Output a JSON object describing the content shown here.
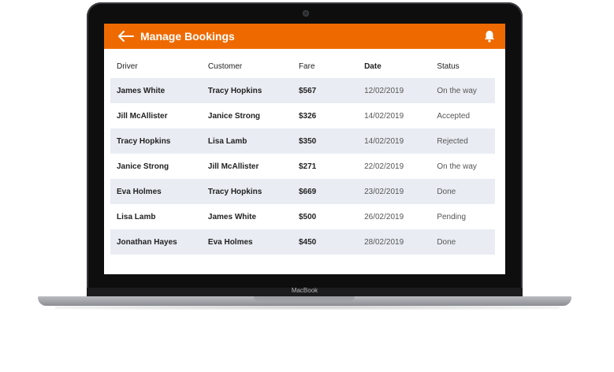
{
  "device": {
    "brand_label": "MacBook"
  },
  "header": {
    "title": "Manage Bookings",
    "back_icon": "arrow-left-icon",
    "bell_icon": "bell-icon"
  },
  "colors": {
    "accent": "#ee6a00",
    "row_shade": "#e9edf3"
  },
  "table": {
    "headers": [
      "Driver",
      "Customer",
      "Fare",
      "Date",
      "Status"
    ],
    "rows": [
      [
        "James White",
        "Tracy Hopkins",
        "$567",
        "12/02/2019",
        "On the way"
      ],
      [
        "Jill McAllister",
        "Janice Strong",
        "$326",
        "14/02/2019",
        "Accepted"
      ],
      [
        "Tracy Hopkins",
        "Lisa Lamb",
        "$350",
        "14/02/2019",
        "Rejected"
      ],
      [
        "Janice Strong",
        "Jill McAllister",
        "$271",
        "22/02/2019",
        "On the way"
      ],
      [
        "Eva Holmes",
        "Tracy Hopkins",
        "$669",
        "23/02/2019",
        "Done"
      ],
      [
        "Lisa Lamb",
        "James White",
        "$500",
        "26/02/2019",
        "Pending"
      ],
      [
        "Jonathan Hayes",
        "Eva Holmes",
        "$450",
        "28/02/2019",
        "Done"
      ]
    ]
  }
}
